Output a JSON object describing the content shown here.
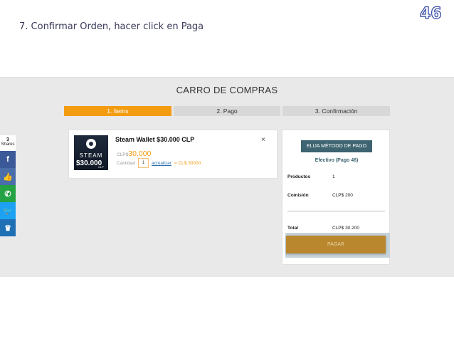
{
  "slide": {
    "heading": "7. Confirmar Orden, hacer click en Paga",
    "logo_text": "46"
  },
  "cart": {
    "title": "CARRO DE COMPRAS",
    "steps": [
      {
        "label": "1. Items",
        "active": true
      },
      {
        "label": "2. Pago",
        "active": false
      },
      {
        "label": "3. Confirmación",
        "active": false
      }
    ]
  },
  "item": {
    "name": "Steam Wallet $30.000 CLP",
    "thumb_brand": "STEAM",
    "thumb_amount": "$30.000",
    "thumb_currency": "CLP",
    "price_currency": "CLP$",
    "price_value": "30.000",
    "qty_label": "Cantidad",
    "qty_value": "1",
    "update_label": "actualizar",
    "subtotal": "= CL$ 30000",
    "remove_glyph": "×"
  },
  "summary": {
    "method_button": "ELIJA MÉTODO DE PAGO",
    "method_name": "Efectivo (Pago 46)",
    "products_label": "Productos",
    "products_value": "1",
    "commission_label": "Comisión",
    "commission_value": "CLP$ 200",
    "total_label": "Total",
    "total_value": "CLP$ 30.200",
    "pay_button": "PAGAR"
  },
  "share": {
    "count": "3",
    "label": "Shares",
    "buttons": [
      {
        "name": "facebook",
        "glyph": "f",
        "color": "#3b5998"
      },
      {
        "name": "like",
        "glyph": "👍",
        "color": "#4a6ea9"
      },
      {
        "name": "whatsapp",
        "glyph": "✆",
        "color": "#25a244"
      },
      {
        "name": "twitter",
        "glyph": "🐦",
        "color": "#1da1f2"
      },
      {
        "name": "crown",
        "glyph": "♛",
        "color": "#1f6fb5"
      }
    ]
  },
  "colors": {
    "accent": "#f39c12",
    "method_button": "#3d6470",
    "pay_button": "#b9872e"
  }
}
